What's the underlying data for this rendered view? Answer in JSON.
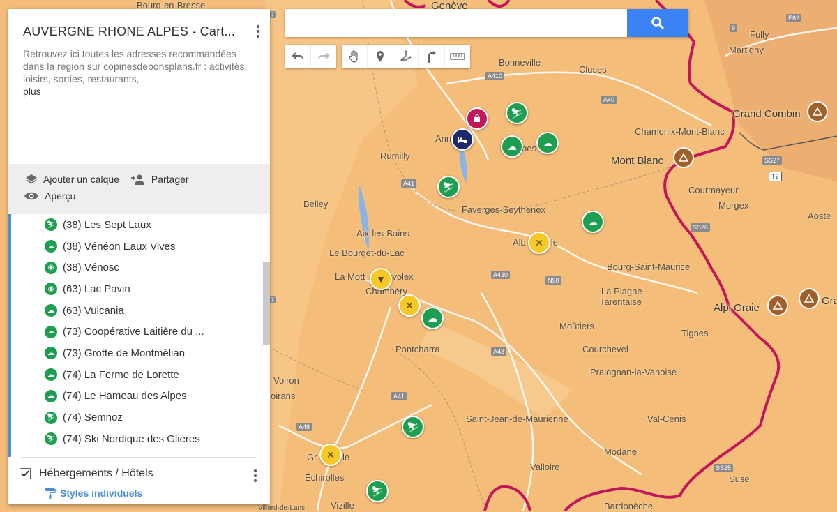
{
  "search": {
    "placeholder": ""
  },
  "panel": {
    "title": "AUVERGNE RHONE ALPES - Cart...",
    "description": "Retrouvez ici toutes les adresses recommandées dans la région sur copinesdebonsplans.fr : activités, loisirs, sorties, restaurants,",
    "more": "plus",
    "actions": {
      "add_layer": "Ajouter un calque",
      "share": "Partager",
      "preview": "Aperçu"
    },
    "list_items": [
      {
        "label": "(38) Les Sept Laux",
        "icon": "ski-icon"
      },
      {
        "label": "(38) Vénéon Eaux Vives",
        "icon": "place-icon"
      },
      {
        "label": "(38) Vénosc",
        "icon": "camera-icon"
      },
      {
        "label": "(63) Lac Pavin",
        "icon": "camera-icon"
      },
      {
        "label": "(63) Vulcania",
        "icon": "place-icon"
      },
      {
        "label": "(73) Coopérative Laitière du ...",
        "icon": "place-icon"
      },
      {
        "label": "(73) Grotte de Montmélian",
        "icon": "place-icon"
      },
      {
        "label": "(74) La Ferme de Lorette",
        "icon": "place-icon"
      },
      {
        "label": "(74) Le Hameau des Alpes",
        "icon": "place-icon"
      },
      {
        "label": "(74) Semnoz",
        "icon": "ski-icon"
      },
      {
        "label": "(74) Ski Nordique des Glières",
        "icon": "ski-icon"
      }
    ],
    "layer2": {
      "name": "Hébergements / Hôtels",
      "styles": "Styles individuels"
    }
  },
  "map_places": {
    "bourg": "Bourg-en-Bresse",
    "geneve": "Genève",
    "fully": "Fully",
    "martigny": "Martigny",
    "bonneville": "Bonneville",
    "cluses": "Cluses",
    "grand_combin": "Grand Combin",
    "chamonix": "Chamonix-Mont-Blanc",
    "mont_blanc": "Mont Blanc",
    "rumilly": "Rumilly",
    "annecy": "Ann",
    "thones": "nes",
    "courmayeur": "Courmayeur",
    "morgex": "Morgex",
    "aoste": "Aoste",
    "belley": "Belley",
    "faverges": "Faverges-Seythenex",
    "aix": "Aix-les-Bains",
    "bourget": "Le Bourget-du-Lac",
    "albertville_a": "Alb",
    "albertville_b": "lle",
    "bourg_st_maurice": "Bourg-Saint-Maurice",
    "motte": "La Mott",
    "motte_b": "rvolex",
    "chambery": "Chambéry",
    "plagne": "La Plagne",
    "tarentaise": "Tarentaise",
    "graie": "Alpi Graie",
    "gra": "Gra",
    "moutiers": "Moûtiers",
    "tignes": "Tignes",
    "pontcharra": "Pontcharra",
    "courchevel": "Courchevel",
    "pralognan": "Pralognan-la-Vanoise",
    "voiron": "Voiron",
    "roirans": "oirans",
    "st_jean": "Saint-Jean-de-Maurienne",
    "val_cenis": "Val-Cenis",
    "grenoble_a": "Gr",
    "grenoble_b": "le",
    "modane": "Modane",
    "valloire": "Valloire",
    "echirolles": "Échirolles",
    "suse": "Suse",
    "vizille": "Vizille",
    "bardonneche": "Bardonèche",
    "villard": "Villard-de-Lans"
  },
  "roads": {
    "e62": "E62",
    "r9": "9",
    "a410": "A410",
    "a40": "A40",
    "ss27": "SS27",
    "t2": "T2",
    "a41a": "A41",
    "ss26": "SS26",
    "a430": "A430",
    "n90": "N90",
    "a43": "A43",
    "a41b": "A41",
    "a48": "A48",
    "ss25": "SS25",
    "r7a": "7",
    "r7b": "7"
  },
  "colors": {
    "map_bg": "#f4bd7a",
    "green": "#1e9e50",
    "yellow": "#f7c928",
    "border": "#c2185b",
    "accent": "#3b82f6"
  }
}
